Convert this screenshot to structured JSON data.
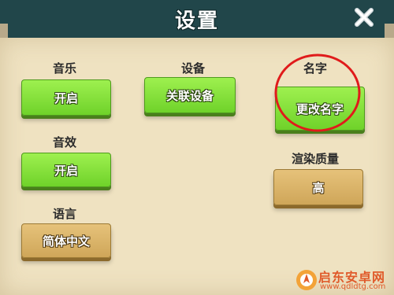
{
  "header": {
    "title": "设置"
  },
  "settings": {
    "music": {
      "label": "音乐",
      "button": "开启"
    },
    "sound": {
      "label": "音效",
      "button": "开启"
    },
    "language": {
      "label": "语言",
      "button": "简体中文"
    },
    "device": {
      "label": "设备",
      "button": "关联设备"
    },
    "name": {
      "label": "名字",
      "button": "更改名字"
    },
    "quality": {
      "label": "渲染质量",
      "button": "高"
    }
  },
  "watermark": {
    "main": "启东安卓网",
    "sub": "www.qdldtg.com"
  },
  "colors": {
    "header": "#21464a",
    "panel": "#efe2c1",
    "green_button": "#7fdc35",
    "gold_button": "#d9b263",
    "highlight_circle": "#e01b1b"
  },
  "icons": {
    "close": "close-icon",
    "watermark_logo": "rocket-logo"
  }
}
